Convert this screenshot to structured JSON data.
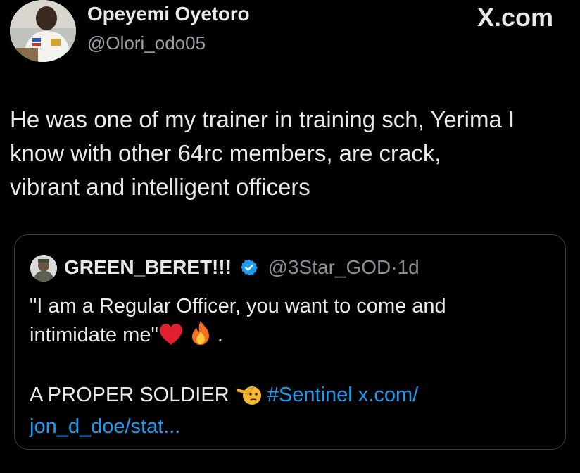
{
  "tweet": {
    "author_name": "Opeyemi Oyetoro",
    "author_handle": "@Olori_odo05",
    "brand": "X.com",
    "text_line1": "He was one of my trainer in training sch, Yerima I",
    "text_line2": "know with other 64rc members, are crack,",
    "text_line3": "vibrant and intelligent officers"
  },
  "quote": {
    "author_name": "GREEN_BERET!!!",
    "author_handle": "@3Star_GOD",
    "separator": "·",
    "time": "1d",
    "line1": "\"I am a Regular Officer, you want to come and",
    "line2_start": "intimidate me\"",
    "line2_end": ".",
    "line3_start": "A PROPER SOLDIER",
    "hashtag": "#Sentinel",
    "link_part1": "x.com/",
    "link_part2": "jon_d_doe/stat..."
  },
  "icons": {
    "verified": "verified-badge-icon",
    "heart": "red-heart-emoji",
    "fire": "fire-emoji",
    "salute": "saluting-face-emoji"
  },
  "colors": {
    "background": "#000000",
    "text": "#e7e9ea",
    "secondary": "#8b9096",
    "link": "#1d9bf0",
    "verified": "#1d9bf0"
  }
}
